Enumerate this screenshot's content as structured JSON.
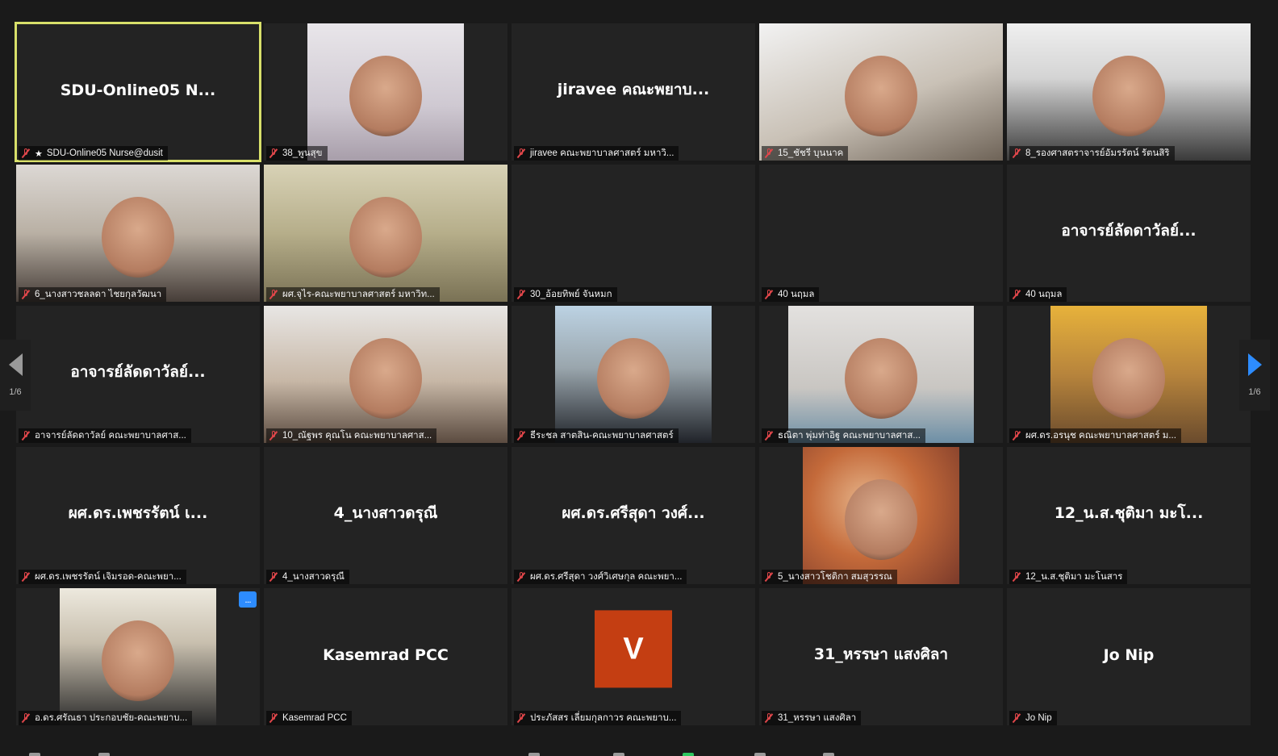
{
  "gallery": {
    "tiles": [
      {
        "big": "SDU-Online05  N...",
        "label": "SDU-Online05 Nurse@dusit",
        "video": false,
        "active": true,
        "pinned": true
      },
      {
        "big": "",
        "label": "38_พูนสุข",
        "video": true,
        "style": "v-wall"
      },
      {
        "big": "jiravee คณะพยาบ...",
        "label": "jiravee คณะพยาบาลศาสตร์ มหาวิ...",
        "video": false
      },
      {
        "big": "",
        "label": "15_ชัชรี บุนนาค",
        "video": true,
        "style": "v-room"
      },
      {
        "big": "",
        "label": "8_รองศาสตราจารย์อัมรรัตน์ รัตนสิริ",
        "video": true,
        "style": "v-office"
      },
      {
        "big": "",
        "label": "6_นางสาวชลลดา  ไชยกุลวัฒนา",
        "video": true,
        "style": "v-pink"
      },
      {
        "big": "",
        "label": "ผศ.จุไร-คณะพยาบาลศาสตร์ มหาวิท...",
        "video": true,
        "style": "v-hall"
      },
      {
        "big": "",
        "label": "30_อ้อยทิพย์  จันหมก",
        "video": false
      },
      {
        "big": "",
        "label": "40 นฤมล",
        "video": false
      },
      {
        "big": "อาจารย์ลัดดาวัลย์...",
        "label": "40 นฤมล",
        "video": false
      },
      {
        "big": "อาจารย์ลัดดาวัลย์...",
        "label": "อาจารย์ลัดดาวัลย์ คณะพยาบาลศาส...",
        "video": false
      },
      {
        "big": "",
        "label": "10_ณัฐพร คุณโน คณะพยาบาลศาส...",
        "video": true,
        "style": "v-window"
      },
      {
        "big": "",
        "label": "ธีระชล สาตสิน-คณะพยาบาลศาสตร์",
        "video": true,
        "style": "v-suit"
      },
      {
        "big": "",
        "label": "ธณิตา พุ่มท่าอิฐ  คณะพยาบาลศาส...",
        "video": true,
        "style": "v-white"
      },
      {
        "big": "",
        "label": "ผศ.ดร.อรนุช คณะพยาบาลศาสตร์ ม...",
        "video": true,
        "style": "v-gold"
      },
      {
        "big": "ผศ.ดร.เพชรรัตน์ เ...",
        "label": "ผศ.ดร.เพชรรัตน์ เจิมรอด-คณะพยา...",
        "video": false
      },
      {
        "big": "4_นางสาวดรุณี",
        "label": "4_นางสาวดรุณี",
        "video": false
      },
      {
        "big": "ผศ.ดร.ศรีสุดา วงศ์...",
        "label": "ผศ.ดร.ศรีสุดา วงศ์วิเศษกุล คณะพยา...",
        "video": false
      },
      {
        "big": "",
        "label": "5_นางสาวโชติกา สมสุวรรณ",
        "video": true,
        "style": "v-leaves"
      },
      {
        "big": "12_น.ส.ชุติมา มะโ...",
        "label": "12_น.ส.ชุติมา มะโนสาร",
        "video": false
      },
      {
        "big": "",
        "label": "อ.ดร.ศรัณธา ประกอบชัย-คณะพยาบ...",
        "video": true,
        "style": "v-man",
        "more": true
      },
      {
        "big": "Kasemrad PCC",
        "label": "Kasemrad PCC",
        "video": false
      },
      {
        "big": "",
        "label": "ประภัสสร เลี่ยมกุลกาวร คณะพยาบ...",
        "video": false,
        "avatar": "V"
      },
      {
        "big": "31_หรรษา แสงศิลา",
        "label": "31_หรรษา แสงศิลา",
        "video": false
      },
      {
        "big": "Jo Nip",
        "label": "Jo Nip",
        "video": false
      }
    ]
  },
  "pagination": {
    "left": "1/6",
    "right": "1/6"
  },
  "more_button": "...",
  "colors": {
    "active_border": "#d8e06a",
    "muted_mic": "#e0464a",
    "accent": "#2d8cff",
    "avatar_bg": "#c43e12"
  },
  "icons": {
    "mic": "mic-muted-icon",
    "pin": "pin-icon",
    "prev": "prev-page-icon",
    "next": "next-page-icon"
  }
}
